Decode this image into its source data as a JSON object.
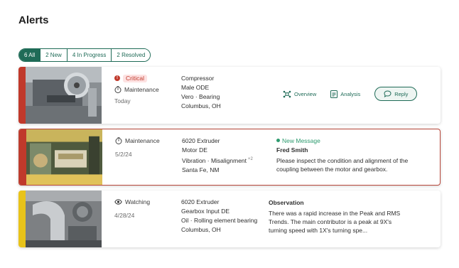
{
  "page": {
    "title": "Alerts"
  },
  "filters": [
    {
      "label": "6 All",
      "active": true
    },
    {
      "label": "2 New",
      "active": false
    },
    {
      "label": "4 In Progress",
      "active": false
    },
    {
      "label": "2 Resolved",
      "active": false
    }
  ],
  "alerts": [
    {
      "stripe_color": "#c0392b",
      "severity": "Critical",
      "status": "Maintenance",
      "status_icon": "timer-icon",
      "date": "Today",
      "asset": [
        "Compressor",
        "Male ODE",
        "Vero · Bearing",
        "Columbus, OH"
      ],
      "actions": {
        "overview": "Overview",
        "analysis": "Analysis",
        "reply": "Reply"
      }
    },
    {
      "stripe_color": "#c0392b",
      "status": "Maintenance",
      "status_icon": "timer-icon",
      "date": "5/2/24",
      "asset": [
        "6020 Extruder",
        "Motor DE",
        "Vibration · Misalignment",
        "Santa Fe, NM"
      ],
      "asset_more": "+2",
      "detail": {
        "badge": "New Message",
        "author": "Fred Smith",
        "body": "Please inspect the condition and alignment of the coupling between the motor and gearbox."
      }
    },
    {
      "stripe_color": "#e8c31a",
      "status": "Watching",
      "status_icon": "eye-icon",
      "date": "4/28/24",
      "asset": [
        "6020 Extruder",
        "Gearbox Input DE",
        "Oil · Rolling element bearing",
        "Columbus, OH"
      ],
      "detail": {
        "title": "Observation",
        "body": "There was a rapid increase in the Peak and RMS Trends. The main contributor is a peak at 9X's turning speed with 1X's turning spe..."
      }
    }
  ]
}
